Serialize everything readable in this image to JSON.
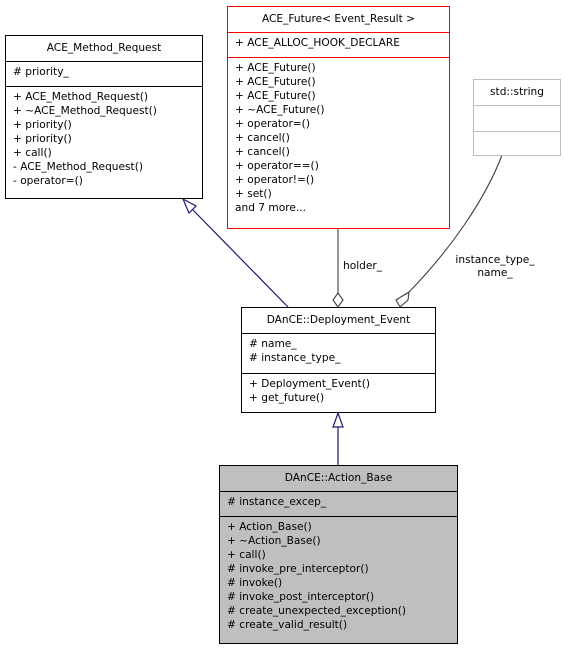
{
  "diagram": {
    "classes": {
      "method_request": {
        "name": "ACE_Method_Request",
        "attributes": [
          "# priority_"
        ],
        "methods": [
          "+ ACE_Method_Request()",
          "+ ~ACE_Method_Request()",
          "+ priority()",
          "+ priority()",
          "+ call()",
          "- ACE_Method_Request()",
          "- operator=()"
        ]
      },
      "future": {
        "name": "ACE_Future< Event_Result >",
        "attributes": [
          "+ ACE_ALLOC_HOOK_DECLARE"
        ],
        "methods": [
          "+ ACE_Future()",
          "+ ACE_Future()",
          "+ ACE_Future()",
          "+ ~ACE_Future()",
          "+ operator=()",
          "+ cancel()",
          "+ cancel()",
          "+ operator==()",
          "+ operator!=()",
          "+ set()",
          "and 7 more..."
        ]
      },
      "string": {
        "name": "std::string",
        "attributes": [],
        "methods": []
      },
      "deployment_event": {
        "name": "DAnCE::Deployment_Event",
        "attributes": [
          "# name_",
          "# instance_type_"
        ],
        "methods": [
          "+ Deployment_Event()",
          "+ get_future()"
        ]
      },
      "action_base": {
        "name": "DAnCE::Action_Base",
        "attributes": [
          "# instance_excep_"
        ],
        "methods": [
          "+ Action_Base()",
          "+ ~Action_Base()",
          "+ call()",
          "# invoke_pre_interceptor()",
          "# invoke()",
          "# invoke_post_interceptor()",
          "# create_unexpected_exception()",
          "# create_valid_result()"
        ]
      }
    },
    "edges": [
      {
        "type": "inheritance",
        "from": "DAnCE::Deployment_Event",
        "to": "ACE_Method_Request"
      },
      {
        "type": "aggregation",
        "from": "DAnCE::Deployment_Event",
        "to": "ACE_Future< Event_Result >",
        "label": "holder_"
      },
      {
        "type": "aggregation",
        "from": "DAnCE::Deployment_Event",
        "to": "std::string",
        "label_line1": "instance_type_",
        "label_line2": "name_"
      },
      {
        "type": "inheritance",
        "from": "DAnCE::Action_Base",
        "to": "DAnCE::Deployment_Event"
      }
    ],
    "colors": {
      "inheritance_edge": "#191970",
      "aggregation_edge": "#404040",
      "template_border": "#ff0000",
      "external_border": "#bfbfbf",
      "current_fill": "#bfbfbf"
    }
  }
}
